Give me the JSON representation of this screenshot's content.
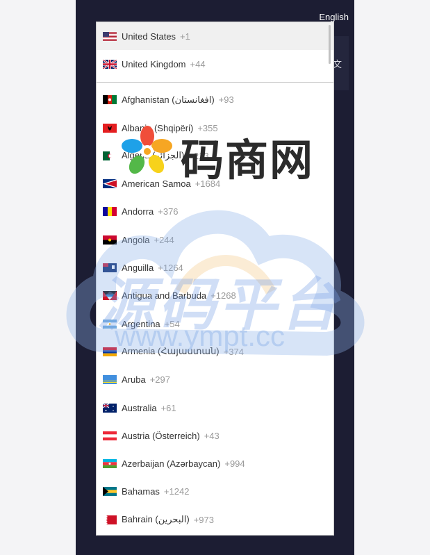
{
  "header": {
    "language": "English",
    "side_tab_char": "文"
  },
  "preferred": [
    {
      "name": "United States",
      "dial": "+1",
      "flag": "us-flag"
    },
    {
      "name": "United Kingdom",
      "dial": "+44",
      "flag": "gb-flag"
    }
  ],
  "countries": [
    {
      "name": "Afghanistan (‫افغانستان‬‎)",
      "dial": "+93",
      "flag": "af-flag"
    },
    {
      "name": "Albania (Shqipëri)",
      "dial": "+355",
      "flag": "al-flag"
    },
    {
      "name": "Algeria (‫الجزائر‬‎)",
      "dial": "+213",
      "flag": "dz-flag"
    },
    {
      "name": "American Samoa",
      "dial": "+1684",
      "flag": "as-flag"
    },
    {
      "name": "Andorra",
      "dial": "+376",
      "flag": "ad-flag"
    },
    {
      "name": "Angola",
      "dial": "+244",
      "flag": "ao-flag"
    },
    {
      "name": "Anguilla",
      "dial": "+1264",
      "flag": "ai-flag"
    },
    {
      "name": "Antigua and Barbuda",
      "dial": "+1268",
      "flag": "ag-flag"
    },
    {
      "name": "Argentina",
      "dial": "+54",
      "flag": "ar-flag"
    },
    {
      "name": "Armenia (Հայաստան)",
      "dial": "+374",
      "flag": "am-flag"
    },
    {
      "name": "Aruba",
      "dial": "+297",
      "flag": "aw-flag"
    },
    {
      "name": "Australia",
      "dial": "+61",
      "flag": "au-flag"
    },
    {
      "name": "Austria (Österreich)",
      "dial": "+43",
      "flag": "at-flag"
    },
    {
      "name": "Azerbaijan (Azərbaycan)",
      "dial": "+994",
      "flag": "az-flag"
    },
    {
      "name": "Bahamas",
      "dial": "+1242",
      "flag": "bs-flag"
    },
    {
      "name": "Bahrain (‫البحرين‬‎)",
      "dial": "+973",
      "flag": "bh-flag"
    }
  ],
  "watermark": {
    "brand_cn": "码商网",
    "platform_cn": "源码平台",
    "url": "www.ympt.cc"
  }
}
